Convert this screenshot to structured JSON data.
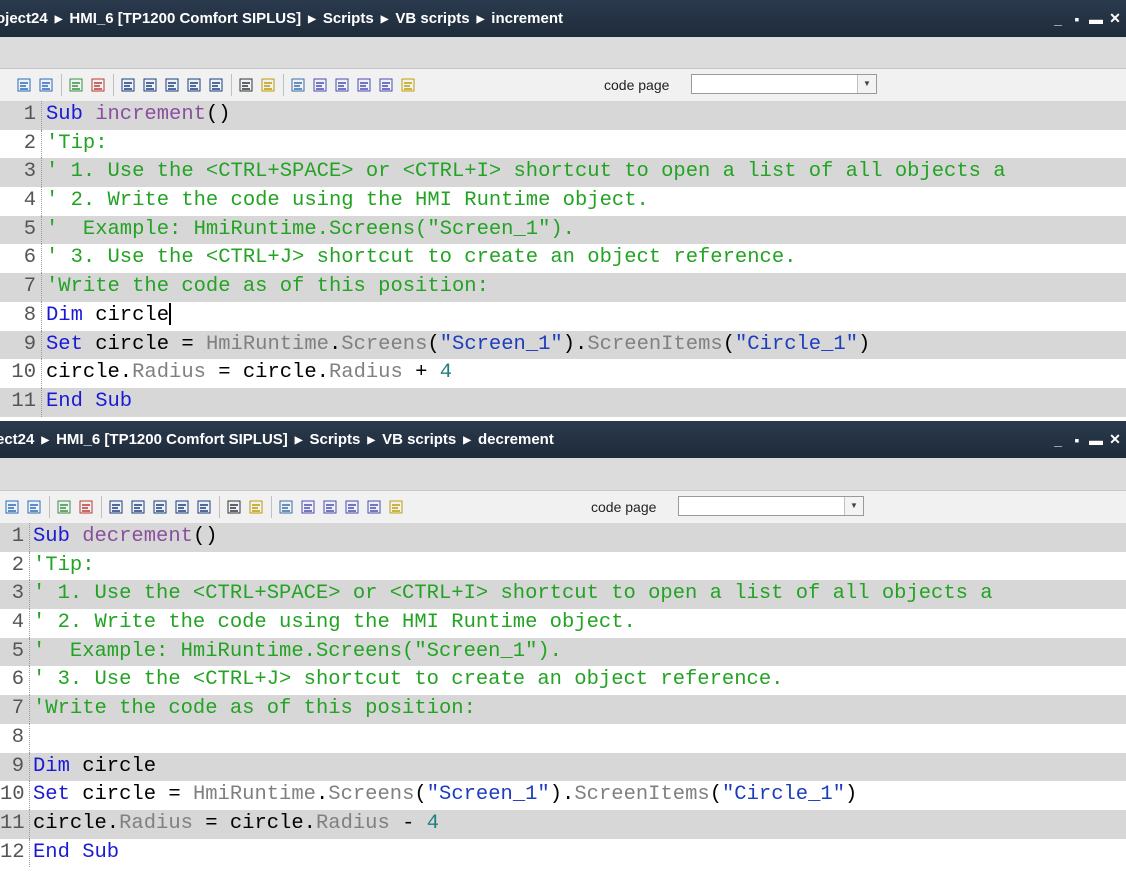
{
  "window_controls": {
    "minimize": "_",
    "restore": "▪",
    "maximize": "▬",
    "close": "✕"
  },
  "code_page_label": "code page",
  "editors": [
    {
      "breadcrumb": [
        "oject24",
        "HMI_6 [TP1200 Comfort SIPLUS]",
        "Scripts",
        "VB scripts",
        "increment"
      ],
      "lines": [
        {
          "num": "1",
          "tokens": [
            {
              "t": "Sub",
              "c": "kw"
            },
            {
              "t": " increment",
              "c": "fn"
            },
            {
              "t": "()",
              "c": "pl"
            }
          ]
        },
        {
          "num": "2",
          "tokens": [
            {
              "t": "'Tip:",
              "c": "cm"
            }
          ]
        },
        {
          "num": "3",
          "tokens": [
            {
              "t": "' 1. Use the <CTRL+SPACE> or <CTRL+I> shortcut to open a list of all objects a",
              "c": "cm"
            }
          ]
        },
        {
          "num": "4",
          "tokens": [
            {
              "t": "' 2. Write the code using the HMI Runtime object.",
              "c": "cm"
            }
          ]
        },
        {
          "num": "5",
          "tokens": [
            {
              "t": "'  Example: HmiRuntime.Screens(\"Screen_1\").",
              "c": "cm"
            }
          ]
        },
        {
          "num": "6",
          "tokens": [
            {
              "t": "' 3. Use the <CTRL+J> shortcut to create an object reference.",
              "c": "cm"
            }
          ]
        },
        {
          "num": "7",
          "tokens": [
            {
              "t": "'Write the code as of this position:",
              "c": "cm"
            }
          ]
        },
        {
          "num": "8",
          "tokens": [
            {
              "t": "Dim",
              "c": "kw"
            },
            {
              "t": " circle",
              "c": "pl"
            }
          ],
          "cursor": true
        },
        {
          "num": "9",
          "tokens": [
            {
              "t": "Set",
              "c": "kw"
            },
            {
              "t": " circle = ",
              "c": "pl"
            },
            {
              "t": "HmiRuntime",
              "c": "gr"
            },
            {
              "t": ".",
              "c": "pl"
            },
            {
              "t": "Screens",
              "c": "gr"
            },
            {
              "t": "(",
              "c": "pl"
            },
            {
              "t": "\"Screen_1\"",
              "c": "str"
            },
            {
              "t": ").",
              "c": "pl"
            },
            {
              "t": "ScreenItems",
              "c": "gr"
            },
            {
              "t": "(",
              "c": "pl"
            },
            {
              "t": "\"Circle_1\"",
              "c": "str"
            },
            {
              "t": ")",
              "c": "pl"
            }
          ]
        },
        {
          "num": "10",
          "tokens": [
            {
              "t": "circle.",
              "c": "pl"
            },
            {
              "t": "Radius",
              "c": "gr"
            },
            {
              "t": " = circle.",
              "c": "pl"
            },
            {
              "t": "Radius",
              "c": "gr"
            },
            {
              "t": " + ",
              "c": "pl"
            },
            {
              "t": "4",
              "c": "num"
            }
          ]
        },
        {
          "num": "11",
          "tokens": [
            {
              "t": "End Sub",
              "c": "kw"
            }
          ]
        }
      ]
    },
    {
      "breadcrumb": [
        "ect24",
        "HMI_6 [TP1200 Comfort SIPLUS]",
        "Scripts",
        "VB scripts",
        "decrement"
      ],
      "lines": [
        {
          "num": "1",
          "tokens": [
            {
              "t": "Sub",
              "c": "kw"
            },
            {
              "t": " decrement",
              "c": "fn"
            },
            {
              "t": "()",
              "c": "pl"
            }
          ]
        },
        {
          "num": "2",
          "tokens": [
            {
              "t": "'Tip:",
              "c": "cm"
            }
          ]
        },
        {
          "num": "3",
          "tokens": [
            {
              "t": "' 1. Use the <CTRL+SPACE> or <CTRL+I> shortcut to open a list of all objects a",
              "c": "cm"
            }
          ]
        },
        {
          "num": "4",
          "tokens": [
            {
              "t": "' 2. Write the code using the HMI Runtime object.",
              "c": "cm"
            }
          ]
        },
        {
          "num": "5",
          "tokens": [
            {
              "t": "'  Example: HmiRuntime.Screens(\"Screen_1\").",
              "c": "cm"
            }
          ]
        },
        {
          "num": "6",
          "tokens": [
            {
              "t": "' 3. Use the <CTRL+J> shortcut to create an object reference.",
              "c": "cm"
            }
          ]
        },
        {
          "num": "7",
          "tokens": [
            {
              "t": "'Write the code as of this position:",
              "c": "cm"
            }
          ]
        },
        {
          "num": "8",
          "tokens": []
        },
        {
          "num": "9",
          "tokens": [
            {
              "t": "Dim",
              "c": "kw"
            },
            {
              "t": " circle",
              "c": "pl"
            }
          ]
        },
        {
          "num": "10",
          "tokens": [
            {
              "t": "Set",
              "c": "kw"
            },
            {
              "t": " circle = ",
              "c": "pl"
            },
            {
              "t": "HmiRuntime",
              "c": "gr"
            },
            {
              "t": ".",
              "c": "pl"
            },
            {
              "t": "Screens",
              "c": "gr"
            },
            {
              "t": "(",
              "c": "pl"
            },
            {
              "t": "\"Screen_1\"",
              "c": "str"
            },
            {
              "t": ").",
              "c": "pl"
            },
            {
              "t": "ScreenItems",
              "c": "gr"
            },
            {
              "t": "(",
              "c": "pl"
            },
            {
              "t": "\"Circle_1\"",
              "c": "str"
            },
            {
              "t": ")",
              "c": "pl"
            }
          ]
        },
        {
          "num": "11",
          "tokens": [
            {
              "t": "circle.",
              "c": "pl"
            },
            {
              "t": "Radius",
              "c": "gr"
            },
            {
              "t": " = circle.",
              "c": "pl"
            },
            {
              "t": "Radius",
              "c": "gr"
            },
            {
              "t": " - ",
              "c": "pl"
            },
            {
              "t": "4",
              "c": "num"
            }
          ]
        },
        {
          "num": "12",
          "tokens": [
            {
              "t": "End Sub",
              "c": "kw"
            }
          ]
        }
      ]
    }
  ],
  "toolbar_icons": [
    "indent-icon",
    "outdent-icon",
    "comment-icon",
    "uncomment-icon",
    "bookmark-toggle-icon",
    "bookmark-previous-icon",
    "bookmark-next-icon",
    "bookmark-clear-icon",
    "goto-line-icon",
    "syntax-check-icon",
    "define-icon",
    "object-list-icon",
    "script-check-icon",
    "script-compile-icon",
    "script-run-icon",
    "script-copy-icon",
    "script-highlight-icon"
  ]
}
